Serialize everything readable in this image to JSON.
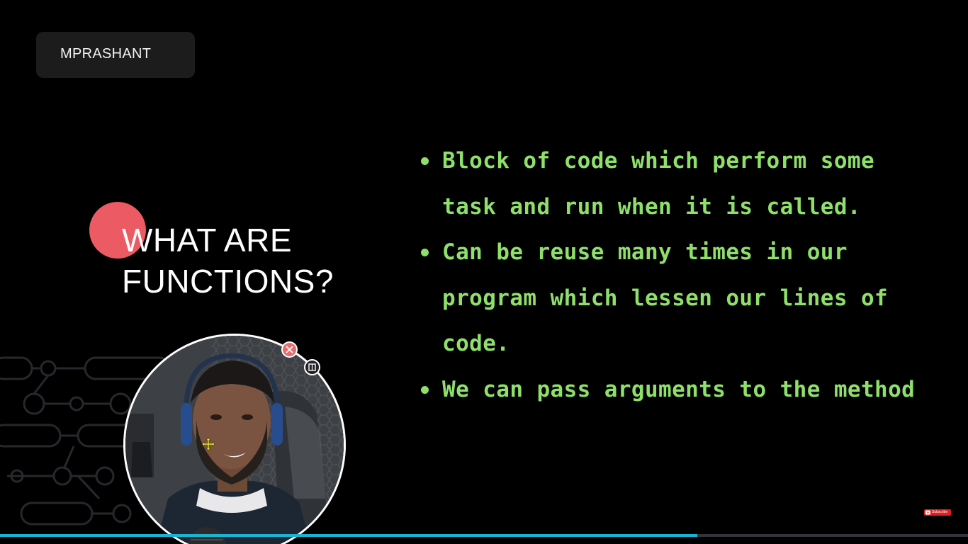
{
  "channel": {
    "name": "MPRASHANT"
  },
  "slide": {
    "heading_line1": "WHAT ARE",
    "heading_line2": "FUNCTIONS?",
    "accent_color": "#ec5b63",
    "bullet_color": "#8ee06a",
    "bullets": [
      {
        "line1": "Block of code which perform some",
        "line2": "task and run when it is called."
      },
      {
        "line1": "Can be reuse many times in our",
        "line2": "program which lessen our lines of",
        "line3": "code."
      },
      {
        "line1": "We can pass arguments to the method"
      }
    ]
  },
  "webcam": {
    "close_icon": "close-icon",
    "resize_icon": "resize-icon",
    "move_icon": "move-icon"
  },
  "video": {
    "progress": 0.72,
    "progress_color": "#19b4d4",
    "subscribe_label": "Subscribe"
  }
}
